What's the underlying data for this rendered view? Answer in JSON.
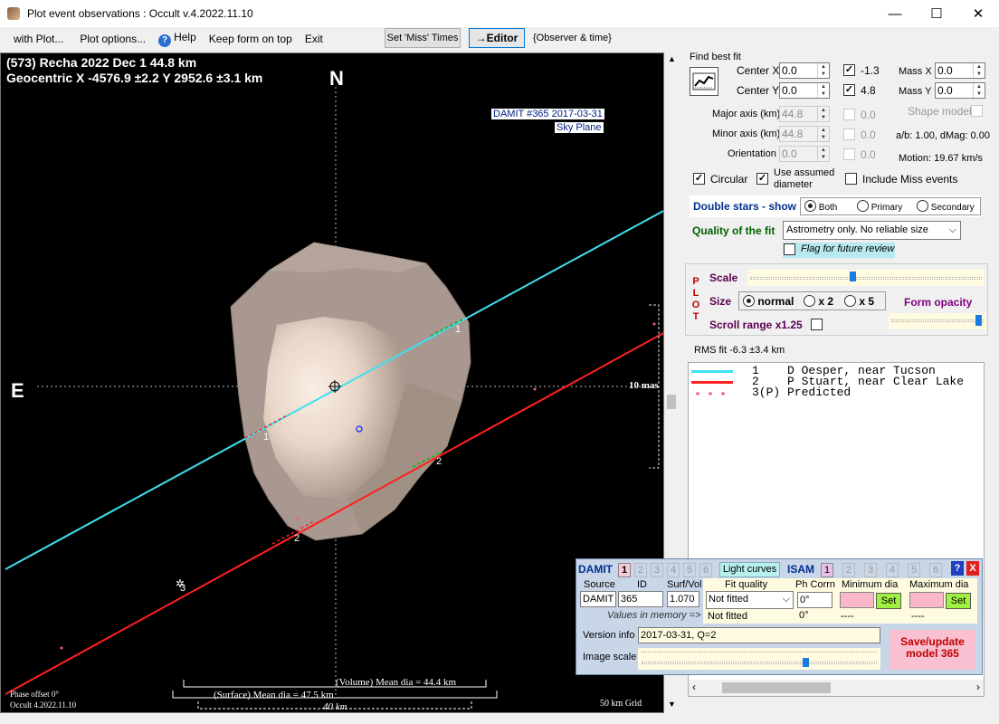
{
  "window": {
    "title": "Plot event observations : Occult v.4.2022.11.10",
    "controls": {
      "minimize": "—",
      "maximize": "☐",
      "close": "✕"
    }
  },
  "menu": {
    "items": [
      "with Plot...",
      "Plot options...",
      "Help",
      "Keep form on top",
      "Exit"
    ],
    "set_miss": "Set 'Miss' Times",
    "editor": "→Editor",
    "observer_time": "{Observer & time}"
  },
  "plot": {
    "line1": "(573) Recha  2022 Dec 1  44.8 km",
    "line2": "Geocentric X -4576.9 ±2.2 Y 2952.6 ±3.1 km",
    "north": "N",
    "east": "E",
    "damit_label": "DAMIT #365 2017-03-31",
    "sky_plane": "Sky Plane",
    "scale_mas": "10 mas",
    "volume_dia": "(Volume) Mean dia = 44.4 km",
    "surface_dia": "(Surface) Mean dia = 47.5 km",
    "scale_40": "40 km",
    "phase": "Phase offset 0°",
    "version": "Occult 4.2022.11.10",
    "grid": "50 km Grid",
    "chord_labels": [
      "1",
      "1",
      "2",
      "2",
      "3"
    ]
  },
  "fit": {
    "find_best_fit": "Find best fit",
    "center_x_label": "Center X",
    "center_x": "0.0",
    "center_y_label": "Center Y",
    "center_y": "0.0",
    "cx_check": "-1.3",
    "cy_check": "4.8",
    "mass_x_label": "Mass X",
    "mass_x": "0.0",
    "mass_y_label": "Mass Y",
    "mass_y": "0.0",
    "major_label": "Major axis (km)",
    "major": "44.8",
    "minor_label": "Minor axis (km)",
    "minor": "44.8",
    "orient_label": "Orientation",
    "orient": "0.0",
    "maj_check": "0.0",
    "min_check": "0.0",
    "ori_check": "0.0",
    "shape_model": "Shape model",
    "ab": "a/b: 1.00, dMag: 0.00",
    "motion": "Motion: 19.67 km/s",
    "circular": "Circular",
    "use_assumed": "Use assumed",
    "diameter": "diameter",
    "include_miss": "Include Miss events",
    "double_stars": "Double stars - show",
    "both": "Both",
    "primary": "Primary",
    "secondary": "Secondary",
    "quality_label": "Quality of the fit",
    "quality_value": "Astrometry only. No reliable size",
    "flag_review": "Flag for future review"
  },
  "plotctl": {
    "letters": [
      "P",
      "L",
      "O",
      "T"
    ],
    "scale": "Scale",
    "size": "Size",
    "normal": "normal",
    "x2": "x 2",
    "x5": "x 5",
    "form_opacity": "Form opacity",
    "scroll_range": "Scroll range x1.25",
    "scale_pos": 0.44,
    "opacity_pos": 0.97
  },
  "rms": "RMS fit -6.3 ±3.4 km",
  "legend": [
    {
      "text": "1    D Oesper, near Tucson",
      "color": "#3fe0f0",
      "style": "solid"
    },
    {
      "text": "2    P Stuart, near Clear Lake",
      "color": "#ff2020",
      "style": "solid"
    },
    {
      "text": "3(P) Predicted",
      "color": "#f05aa0",
      "style": "dots"
    }
  ],
  "damit": {
    "damit_label": "DAMIT",
    "numbers": [
      "1",
      "2",
      "3",
      "4",
      "5",
      "6"
    ],
    "light_curves": "Light curves",
    "isam_label": "ISAM",
    "source_hdr": "Source",
    "id_hdr": "ID",
    "surfvol_hdr": "Surf/Vol",
    "fitq_hdr": "Fit quality",
    "phcorr_hdr": "Ph Corrn",
    "min_hdr": "Minimum dia",
    "max_hdr": "Maximum dia",
    "source": "DAMIT",
    "id": "365",
    "surfvol": "1.070",
    "fitq": "Not fitted",
    "phcorr": "0°",
    "set": "Set",
    "memory": "Values in memory =>",
    "fitq_mem": "Not fitted",
    "ph_mem": "0°",
    "min_mem": "----",
    "max_mem": "----",
    "version_label": "Version info",
    "version": "2017-03-31, Q=2",
    "image_scale": "Image scale",
    "save": "Save/update model 365",
    "help": "?",
    "close": "X",
    "image_scale_pos": 0.7
  }
}
